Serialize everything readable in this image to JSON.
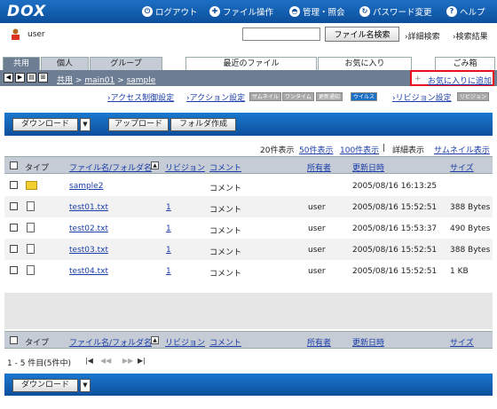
{
  "header": {
    "logo": "DOX",
    "nav": [
      {
        "label": "ログアウト",
        "icon": "logout-icon"
      },
      {
        "label": "ファイル操作",
        "icon": "file-ops-icon"
      },
      {
        "label": "管理・照会",
        "icon": "admin-icon"
      },
      {
        "label": "パスワード変更",
        "icon": "password-icon"
      },
      {
        "label": "ヘルプ",
        "icon": "help-icon"
      }
    ]
  },
  "user": {
    "name": "user",
    "search_placeholder": "",
    "search_button": "ファイル名検索",
    "advanced_search": "詳細検索",
    "search_results": "検索結果"
  },
  "tabs": {
    "shared": "共用",
    "personal": "個人",
    "group": "グループ",
    "recent": "最近のファイル",
    "favorites": "お気に入り",
    "trash": "ごみ箱"
  },
  "path": {
    "root": "共用",
    "sep1": ">",
    "seg1": "main01",
    "sep2": ">",
    "seg2": "sample",
    "add_favorite": "お気に入りに追加"
  },
  "settings": {
    "access": "アクセス制御設定",
    "action": "アクション設定",
    "badge_thumb": "サムネイル",
    "badge_onetime": "ワンタイム",
    "badge_notify": "更新通知",
    "badge_virus": "ウイルス",
    "revision": "リビジョン設定",
    "badge_revision": "リビジョン"
  },
  "toolbar": {
    "download": "ダウンロード",
    "upload": "アップロード",
    "new_folder": "フォルダ作成"
  },
  "view": {
    "count20": "20件表示",
    "count50": "50件表示",
    "count100": "100件表示",
    "sep": "|",
    "detail": "詳細表示",
    "thumbnail": "サムネイル表示"
  },
  "table": {
    "headers": {
      "type": "タイプ",
      "name": "ファイル名/フォルダ名",
      "revision": "リビジョン",
      "comment": "コメント",
      "owner": "所有者",
      "updated": "更新日時",
      "size": "サイズ"
    },
    "rows": [
      {
        "kind": "folder",
        "name": "sample2",
        "revision": "",
        "comment": "コメント",
        "owner": "",
        "updated": "2005/08/16 16:13:25",
        "size": ""
      },
      {
        "kind": "file",
        "name": "test01.txt",
        "revision": "1",
        "comment": "コメント",
        "owner": "user",
        "updated": "2005/08/16 15:52:51",
        "size": "388 Bytes"
      },
      {
        "kind": "file",
        "name": "test02.txt",
        "revision": "1",
        "comment": "コメント",
        "owner": "user",
        "updated": "2005/08/16 15:53:37",
        "size": "490 Bytes"
      },
      {
        "kind": "file",
        "name": "test03.txt",
        "revision": "1",
        "comment": "コメント",
        "owner": "user",
        "updated": "2005/08/16 15:52:51",
        "size": "388 Bytes"
      },
      {
        "kind": "file",
        "name": "test04.txt",
        "revision": "1",
        "comment": "コメント",
        "owner": "user",
        "updated": "2005/08/16 15:52:51",
        "size": "1 KB"
      }
    ]
  },
  "pager": {
    "summary": "1 - 5 件目(5件中)",
    "first": "|◀",
    "prev": "◀◀",
    "next": "▶▶",
    "last": "▶|"
  }
}
